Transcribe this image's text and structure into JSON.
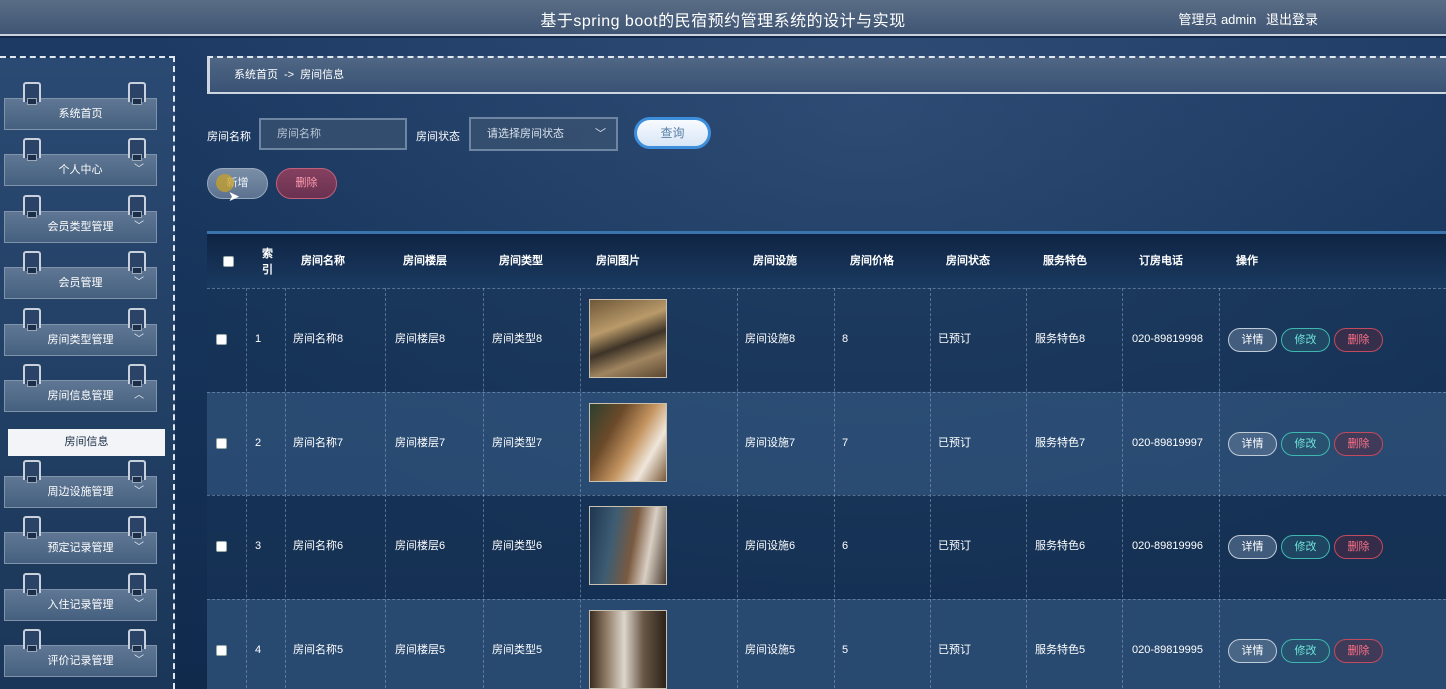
{
  "header": {
    "title": "基于spring boot的民宿预约管理系统的设计与实现",
    "user_label": "管理员 admin",
    "logout_label": "退出登录"
  },
  "sidebar": {
    "items": [
      {
        "label": "系统首页",
        "has_submenu": false
      },
      {
        "label": "个人中心",
        "has_submenu": true
      },
      {
        "label": "会员类型管理",
        "has_submenu": true
      },
      {
        "label": "会员管理",
        "has_submenu": true
      },
      {
        "label": "房间类型管理",
        "has_submenu": true
      },
      {
        "label": "房间信息管理",
        "has_submenu": true,
        "expanded": true
      },
      {
        "label": "周边设施管理",
        "has_submenu": true
      },
      {
        "label": "预定记录管理",
        "has_submenu": true
      },
      {
        "label": "入住记录管理",
        "has_submenu": true
      },
      {
        "label": "评价记录管理",
        "has_submenu": true
      }
    ],
    "active_subitem": "房间信息",
    "chevron_down": "﹀",
    "chevron_up": "︿"
  },
  "breadcrumb": {
    "home": "系统首页",
    "separator": "->",
    "current": "房间信息"
  },
  "search": {
    "room_name_label": "房间名称",
    "room_name_placeholder": "房间名称",
    "room_status_label": "房间状态",
    "room_status_value": "请选择房间状态",
    "query_label": "查询"
  },
  "actions": {
    "add_label": "新增",
    "delete_label": "删除"
  },
  "table": {
    "headers": {
      "index": "索引",
      "room_name": "房间名称",
      "floor": "房间楼层",
      "type": "房间类型",
      "image": "房间图片",
      "facilities": "房间设施",
      "price": "房间价格",
      "status": "房间状态",
      "feature": "服务特色",
      "phone": "订房电话",
      "ops": "操作"
    },
    "row_actions": {
      "detail": "详情",
      "edit": "修改",
      "delete": "删除"
    },
    "rows": [
      {
        "index": "1",
        "room_name": "房间名称8",
        "floor": "房间楼层8",
        "type": "房间类型8",
        "facilities": "房间设施8",
        "price": "8",
        "status": "已预订",
        "feature": "服务特色8",
        "phone": "020-89819998"
      },
      {
        "index": "2",
        "room_name": "房间名称7",
        "floor": "房间楼层7",
        "type": "房间类型7",
        "facilities": "房间设施7",
        "price": "7",
        "status": "已预订",
        "feature": "服务特色7",
        "phone": "020-89819997"
      },
      {
        "index": "3",
        "room_name": "房间名称6",
        "floor": "房间楼层6",
        "type": "房间类型6",
        "facilities": "房间设施6",
        "price": "6",
        "status": "已预订",
        "feature": "服务特色6",
        "phone": "020-89819996"
      },
      {
        "index": "4",
        "room_name": "房间名称5",
        "floor": "房间楼层5",
        "type": "房间类型5",
        "facilities": "房间设施5",
        "price": "5",
        "status": "已预订",
        "feature": "服务特色5",
        "phone": "020-89819995"
      }
    ]
  }
}
